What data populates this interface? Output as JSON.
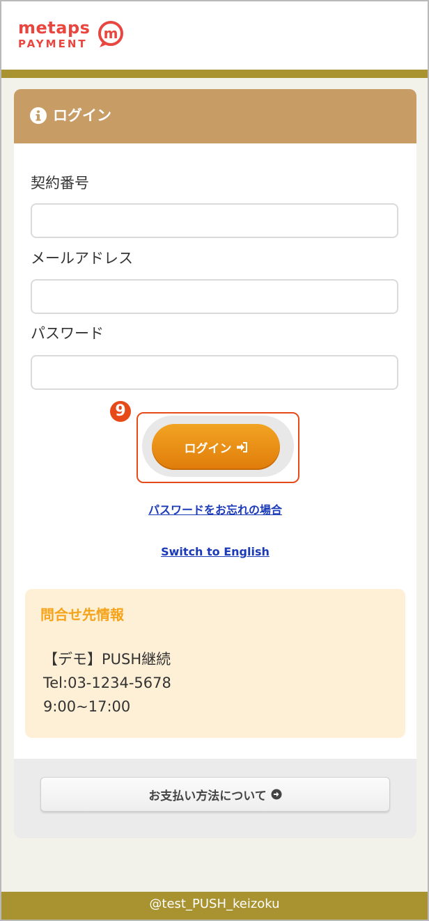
{
  "brand": {
    "logo_top": "metaps",
    "logo_bottom": "PAYMENT",
    "logo_mark": "m",
    "accent_color": "#e8463f"
  },
  "login_card": {
    "title": "ログイン",
    "title_icon": "info-icon",
    "header_color": "#c79c65"
  },
  "form": {
    "contract_label": "契約番号",
    "contract_value": "",
    "email_label": "メールアドレス",
    "email_value": "",
    "password_label": "パスワード",
    "password_value": ""
  },
  "annotation": {
    "step_number": "9",
    "color": "#e64a19"
  },
  "login_button": {
    "label": "ログイン",
    "icon": "sign-in-icon",
    "color": "#f0961a"
  },
  "links": {
    "forgot_password": "パスワードをお忘れの場合",
    "switch_language": "Switch to English"
  },
  "contact": {
    "title": "問合せ先情報",
    "name": "【デモ】PUSH継続",
    "tel": "Tel:03-1234-5678",
    "hours": "9:00~17:00"
  },
  "payment_info_button": {
    "label": "お支払い方法について",
    "icon": "arrow-circle-right-icon"
  },
  "footer": {
    "text": "@test_PUSH_keizoku",
    "color": "#a99331"
  }
}
